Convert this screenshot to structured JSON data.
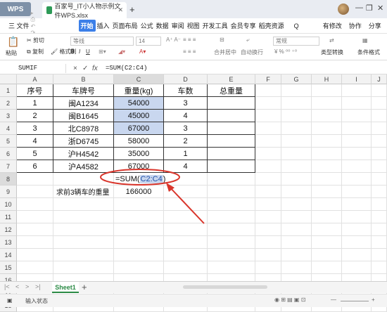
{
  "app": {
    "wps_label": "WPS",
    "tabs": [
      {
        "label": "百家号_IT小人物示例文件WPS.xlsx"
      }
    ],
    "new_tab": "+",
    "window_controls": [
      "—",
      "❐",
      "✕"
    ]
  },
  "menu": {
    "file": "三 文件",
    "items": [
      "开始",
      "插入",
      "页面布局",
      "公式",
      "数据",
      "审阅",
      "视图",
      "开发工具",
      "会员专享",
      "稻壳资源"
    ],
    "active": "开始",
    "search": "Q",
    "right": [
      "有修改",
      "协作",
      "分享"
    ]
  },
  "toolbar": {
    "cut": "剪切",
    "paste": "粘贴",
    "copy": "复制",
    "format_painter": "格式刷",
    "font_name": "等线",
    "font_size": "14",
    "merge": "合并居中",
    "wrap": "自动换行",
    "number_format": "常规",
    "type_convert": "类型转换",
    "conditional_format": "条件格式"
  },
  "formula_bar": {
    "name_box": "SUMIF",
    "cancel": "×",
    "confirm": "✓",
    "fx": "fx",
    "formula": "=SUM(C2:C4)"
  },
  "grid": {
    "columns": [
      "A",
      "B",
      "C",
      "D",
      "E",
      "F",
      "G",
      "H",
      "I",
      "J"
    ],
    "rows": [
      "1",
      "2",
      "3",
      "4",
      "5",
      "6",
      "7",
      "8",
      "9",
      "10",
      "11",
      "12",
      "13",
      "14",
      "15",
      "16",
      "17",
      "18"
    ],
    "headers": [
      "序号",
      "车牌号",
      "重量(kg)",
      "车数",
      "总重量"
    ],
    "data": [
      [
        "1",
        "闽A1234",
        "54000",
        "3",
        ""
      ],
      [
        "2",
        "闽B1645",
        "45000",
        "4",
        ""
      ],
      [
        "3",
        "北C8978",
        "67000",
        "3",
        ""
      ],
      [
        "4",
        "浙D6745",
        "58000",
        "2",
        ""
      ],
      [
        "5",
        "沪H4542",
        "35000",
        "1",
        ""
      ],
      [
        "6",
        "沪A4582",
        "67000",
        "4",
        ""
      ]
    ],
    "editing_formula_prefix": "=SUM(",
    "editing_formula_ref": "C2:C4",
    "editing_formula_suffix": ")",
    "row9_label": "求前3辆车的重量",
    "row9_value": "166000"
  },
  "sheet": {
    "nav": [
      "|<",
      "<",
      ">",
      ">|"
    ],
    "tab": "Sheet1",
    "add": "+"
  },
  "status": {
    "mode": "输入状态"
  },
  "colors": {
    "menu_active": "#3c7fe8",
    "selection_fill": "#c9d7ef",
    "annotation_red": "#d9352b",
    "sheet_green": "#2b8a45"
  }
}
